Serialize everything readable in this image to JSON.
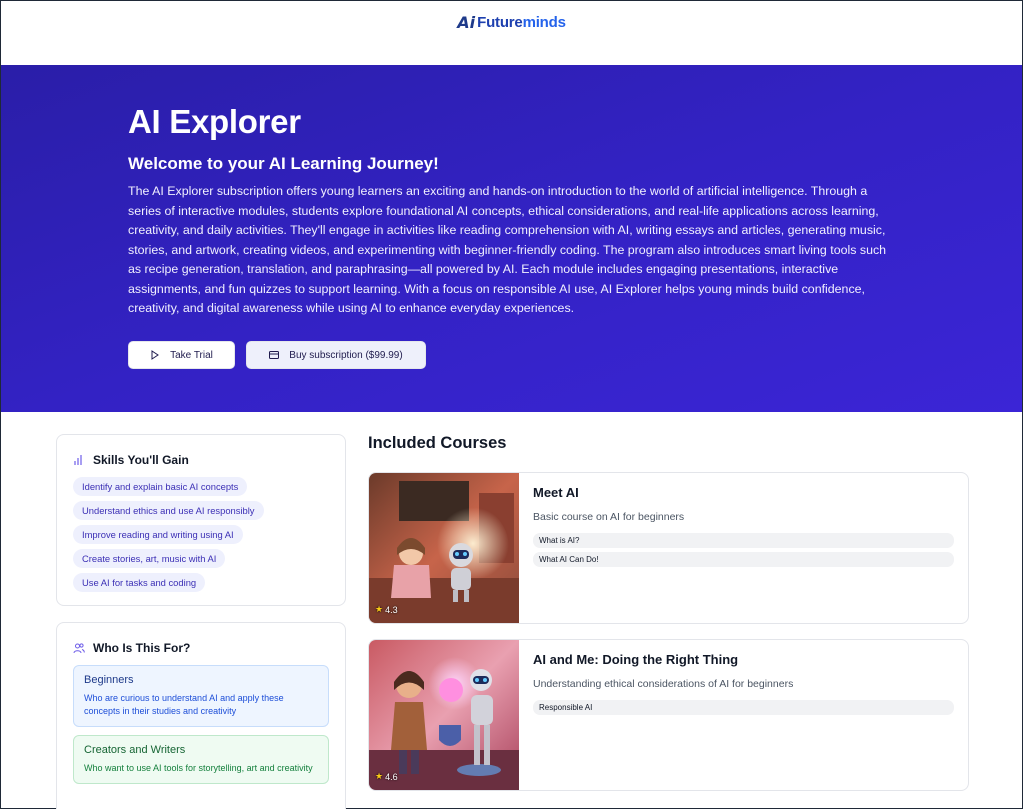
{
  "brand": {
    "mark": "Ai",
    "name_a": "Future",
    "name_b": "minds"
  },
  "hero": {
    "title": "AI Explorer",
    "subtitle": "Welcome to your AI Learning Journey!",
    "description": "The AI Explorer subscription offers young learners an exciting and hands-on introduction to the world of artificial intelligence. Through a series of interactive modules, students explore foundational AI concepts, ethical considerations, and real-life applications across learning, creativity, and daily activities. They'll engage in activities like reading comprehension with AI, writing essays and articles, generating music, stories, and artwork, creating videos, and experimenting with beginner-friendly coding. The program also introduces smart living tools such as recipe generation, translation, and paraphrasing—all powered by AI. Each module includes engaging presentations, interactive assignments, and fun quizzes to support learning. With a focus on responsible AI use, AI Explorer helps young minds build confidence, creativity, and digital awareness while using AI to enhance everyday experiences.",
    "trial_label": "Take Trial",
    "buy_label": "Buy subscription ($99.99)",
    "colors": {
      "gradient_start": "#2a1ea8",
      "gradient_end": "#3b25d6"
    }
  },
  "skills": {
    "title": "Skills You'll Gain",
    "icon": "bar-chart-icon",
    "items": [
      "Identify and explain basic AI concepts",
      "Understand ethics and use AI responsibly",
      "Improve reading and writing using AI",
      "Create stories, art, music with AI",
      "Use AI for tasks and coding"
    ]
  },
  "audience": {
    "title": "Who Is This For?",
    "icon": "users-icon",
    "items": [
      {
        "title": "Beginners",
        "desc": "Who are curious to understand AI and apply these concepts in their studies and creativity"
      },
      {
        "title": "Creators and Writers",
        "desc": "Who want to use AI tools for storytelling, art and creativity"
      }
    ]
  },
  "courses": {
    "title": "Included Courses",
    "items": [
      {
        "name": "Meet AI",
        "desc": "Basic course on AI for beginners",
        "rating": "4.3",
        "tags": [
          "What is AI?",
          "What AI Can Do!"
        ]
      },
      {
        "name": "AI and Me: Doing the Right Thing",
        "desc": "Understanding ethical considerations of AI for beginners",
        "rating": "4.6",
        "tags": [
          "Responsible AI"
        ]
      }
    ]
  }
}
